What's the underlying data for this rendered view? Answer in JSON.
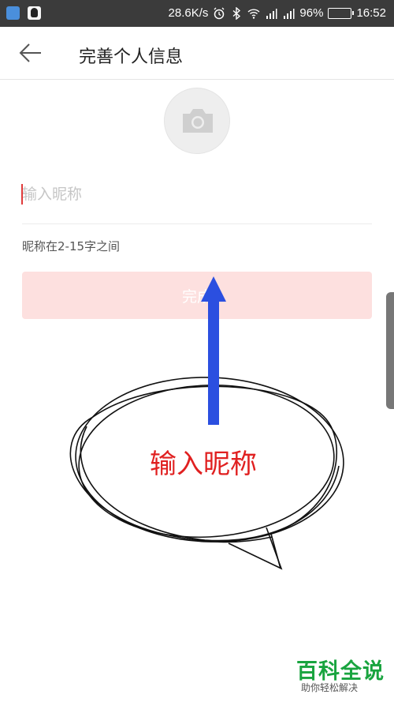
{
  "status_bar": {
    "speed": "28.6K/s",
    "battery_percent": "96%",
    "time": "16:52",
    "battery_level": 0.96,
    "icons": [
      "shield-app-icon",
      "qq-app-icon",
      "alarm-icon",
      "bluetooth-icon",
      "wifi-icon",
      "signal-icon",
      "signal-icon-2",
      "battery-icon"
    ]
  },
  "header": {
    "title": "完善个人信息",
    "back_icon": "arrow-left-icon"
  },
  "avatar": {
    "icon": "camera-icon"
  },
  "nickname": {
    "placeholder": "输入昵称",
    "value": "",
    "hint": "昵称在2-15字之间"
  },
  "submit": {
    "label": "完成"
  },
  "annotation": {
    "text": "输入昵称",
    "arrow_color": "#2b4fe0",
    "text_color": "#e02020"
  },
  "watermark": {
    "main": "百科全说",
    "sub": "助你轻松解决",
    "color": "#19a43f"
  },
  "colors": {
    "accent": "#e03b3b",
    "button_bg": "#fde0df",
    "status_bar_bg": "#3b3b3b"
  }
}
